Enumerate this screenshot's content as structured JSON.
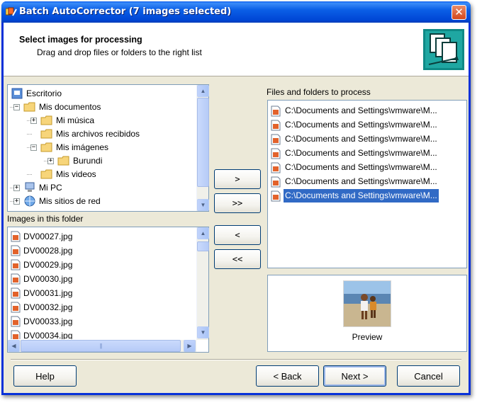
{
  "window": {
    "title": "Batch AutoCorrector (7 images selected)",
    "close_glyph": "✕"
  },
  "header": {
    "title": "Select images for processing",
    "subtitle": "Drag and drop files or folders to the right list",
    "logo_icon": "stacked-photos-icon"
  },
  "folder_tree": {
    "items": [
      {
        "label": "Escritorio",
        "icon": "desktop-icon",
        "expander": ""
      },
      {
        "label": "Mis documentos",
        "icon": "open-folder-icon",
        "expander": "−"
      },
      {
        "label": "Mi música",
        "icon": "music-folder-icon",
        "expander": "+"
      },
      {
        "label": "Mis archivos recibidos",
        "icon": "folder-icon",
        "expander": ""
      },
      {
        "label": "Mis imágenes",
        "icon": "pictures-folder-icon",
        "expander": "−"
      },
      {
        "label": "Burundi",
        "icon": "folder-icon",
        "expander": "+"
      },
      {
        "label": "Mis videos",
        "icon": "video-folder-icon",
        "expander": ""
      },
      {
        "label": "Mi PC",
        "icon": "computer-icon",
        "expander": "+"
      },
      {
        "label": "Mis sitios de red",
        "icon": "network-icon",
        "expander": "+"
      }
    ]
  },
  "images_panel": {
    "label": "Images in this folder",
    "files": [
      "DV00027.jpg",
      "DV00028.jpg",
      "DV00029.jpg",
      "DV00030.jpg",
      "DV00031.jpg",
      "DV00032.jpg",
      "DV00033.jpg",
      "DV00034.jpg"
    ]
  },
  "transfer_buttons": {
    "add": ">",
    "add_all": ">>",
    "remove": "<",
    "remove_all": "<<"
  },
  "process_panel": {
    "label": "Files and folders to process",
    "items": [
      "C:\\Documents and Settings\\vmware\\M...",
      "C:\\Documents and Settings\\vmware\\M...",
      "C:\\Documents and Settings\\vmware\\M...",
      "C:\\Documents and Settings\\vmware\\M...",
      "C:\\Documents and Settings\\vmware\\M...",
      "C:\\Documents and Settings\\vmware\\M...",
      "C:\\Documents and Settings\\vmware\\M..."
    ],
    "selected_index": 6
  },
  "preview": {
    "label": "Preview"
  },
  "footer": {
    "help": "Help",
    "back": "< Back",
    "next": "Next >",
    "cancel": "Cancel"
  },
  "colors": {
    "titlebar": "#0058e6",
    "selection": "#316ac5",
    "dialog_bg": "#ece9d8",
    "border_blue": "#7f9db9"
  }
}
